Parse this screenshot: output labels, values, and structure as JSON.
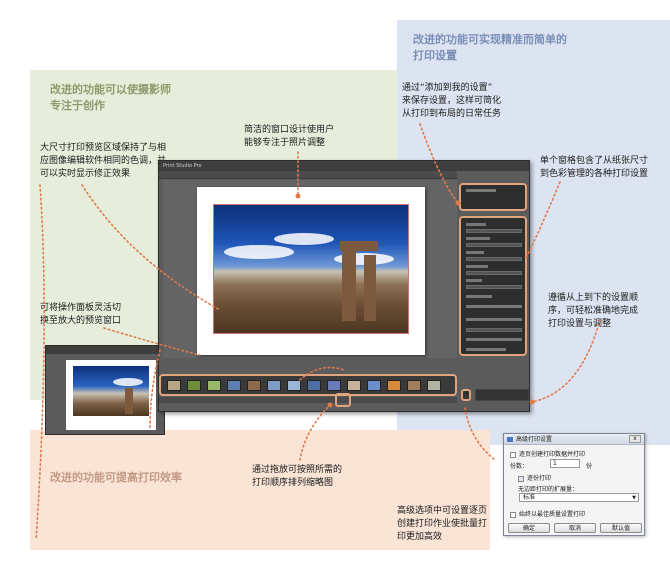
{
  "panels": {
    "green_heading_line1": "改进的功能可以使摄影师",
    "green_heading_line2": "专注于创作",
    "blue_heading_line1": "改进的功能可实现精准而简单的",
    "blue_heading_line2": "打印设置",
    "peach_heading": "改进的功能可提高打印效率"
  },
  "notes": {
    "large_preview": [
      "大尺寸打印预览区域保持了与相",
      "应图像编辑软件相同的色调，并",
      "可以实时显示修正效果"
    ],
    "simple_window": [
      "简洁的窗口设计使用户",
      "能够专注于照片调整"
    ],
    "add_to_settings": [
      "通过“添加到我的设置”",
      "来保存设置，这样可简化",
      "从打印到布局的日常任务"
    ],
    "single_pane": [
      "单个窗格包含了从纸张尺寸",
      "到色彩管理的各种打印设置"
    ],
    "panel_toggle": [
      "可将操作面板灵活切",
      "换至放大的预览窗口"
    ],
    "top_to_bottom": [
      "遵循从上到下的设置顺",
      "序，可轻松准确地完成",
      "打印设置与调整"
    ],
    "drag_thumbnails": [
      "通过拖放可按照所需的",
      "打印顺序排列缩略图"
    ],
    "advanced_options": [
      "高级选项中可设置逐页",
      "创建打印作业使批量打",
      "印更加高效"
    ]
  },
  "colors": {
    "green_panel": "#e6eedb",
    "blue_panel": "#dde4f1",
    "peach_panel": "#f9e4d6",
    "highlight_orange": "#e0a37c",
    "dotted_line": "#e07a4a"
  },
  "dialog": {
    "title": "高级打印设置",
    "close_glyph": "x",
    "option_page_jobs": "逐页创建打印数据并打印",
    "copies_label": "份数：",
    "copies_value": "1",
    "copies_unit": "份",
    "option_collate": "逐份打印",
    "paper_quality_label": "无边距打印的扩展量：",
    "paper_quality_value": "标准",
    "option_print_quality": "始终以最佳质量设置打印",
    "btn_ok": "确定",
    "btn_cancel": "取消",
    "btn_default": "默认值"
  },
  "app_window": {
    "title": "Print Studio Pro"
  },
  "icons": {
    "gear": "gear-icon",
    "window_close": "close-icon"
  }
}
